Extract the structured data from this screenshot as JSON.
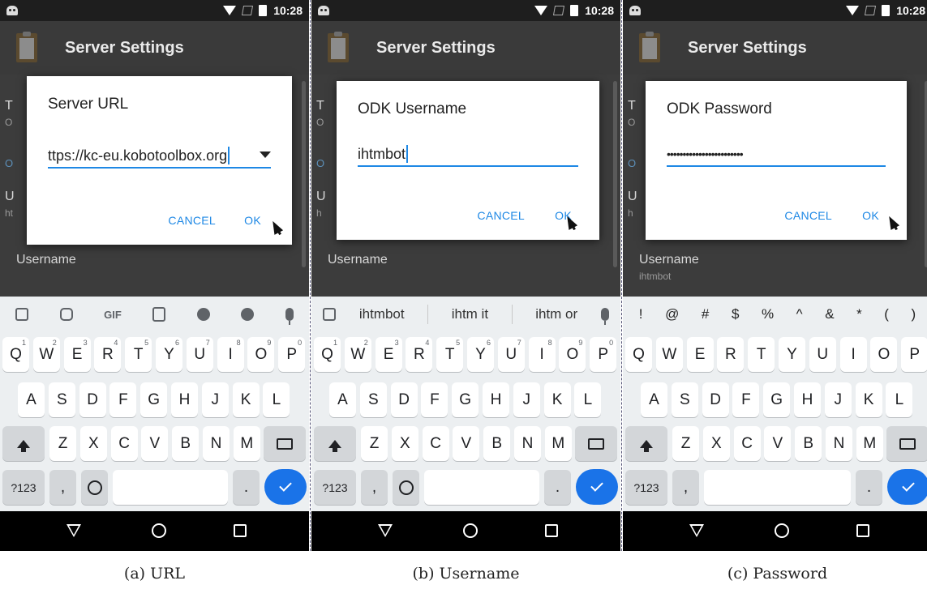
{
  "status_bar": {
    "time": "10:28"
  },
  "app_bar": {
    "title": "Server Settings"
  },
  "panels": [
    {
      "caption": "(a) URL",
      "dialog": {
        "title": "Server URL",
        "value": "ttps://kc-eu.kobotoolbox.org",
        "cancel": "CANCEL",
        "ok": "OK"
      },
      "background": {
        "item1_initial": "T",
        "item1_sub_initial": "O",
        "item2_initial": "O",
        "item3_initial": "U",
        "item3_sub_initial": "ht",
        "username_label": "Username",
        "username_value": ""
      },
      "keyboard": {
        "row1": [
          {
            "k": "Q",
            "h": "1"
          },
          {
            "k": "W",
            "h": "2"
          },
          {
            "k": "E",
            "h": "3"
          },
          {
            "k": "R",
            "h": "4"
          },
          {
            "k": "T",
            "h": "5"
          },
          {
            "k": "Y",
            "h": "6"
          },
          {
            "k": "U",
            "h": "7"
          },
          {
            "k": "I",
            "h": "8"
          },
          {
            "k": "O",
            "h": "9"
          },
          {
            "k": "P",
            "h": "0"
          }
        ],
        "row2": [
          "A",
          "S",
          "D",
          "F",
          "G",
          "H",
          "J",
          "K",
          "L"
        ],
        "row3": [
          "Z",
          "X",
          "C",
          "V",
          "B",
          "N",
          "M"
        ],
        "mode_key": "?123",
        "comma_key": ",",
        "period_key": "."
      }
    },
    {
      "caption": "(b) Username",
      "dialog": {
        "title": "ODK Username",
        "value": "ihtmbot",
        "cancel": "CANCEL",
        "ok": "OK"
      },
      "background": {
        "item1_initial": "T",
        "item1_sub_initial": "O",
        "item2_initial": "O",
        "item3_initial": "U",
        "item3_sub_initial": "h",
        "username_label": "Username",
        "username_value": ""
      },
      "suggestions": [
        "ihtmbot",
        "ihtm it",
        "ihtm or"
      ],
      "keyboard": {
        "row1": [
          {
            "k": "Q",
            "h": "1"
          },
          {
            "k": "W",
            "h": "2"
          },
          {
            "k": "E",
            "h": "3"
          },
          {
            "k": "R",
            "h": "4"
          },
          {
            "k": "T",
            "h": "5"
          },
          {
            "k": "Y",
            "h": "6"
          },
          {
            "k": "U",
            "h": "7"
          },
          {
            "k": "I",
            "h": "8"
          },
          {
            "k": "O",
            "h": "9"
          },
          {
            "k": "P",
            "h": "0"
          }
        ],
        "row2": [
          "A",
          "S",
          "D",
          "F",
          "G",
          "H",
          "J",
          "K",
          "L"
        ],
        "row3": [
          "Z",
          "X",
          "C",
          "V",
          "B",
          "N",
          "M"
        ],
        "mode_key": "?123",
        "comma_key": ",",
        "period_key": "."
      }
    },
    {
      "caption": "(c) Password",
      "dialog": {
        "title": "ODK Password",
        "value": "••••••••••••••••••••••••",
        "cancel": "CANCEL",
        "ok": "OK"
      },
      "background": {
        "item1_initial": "T",
        "item1_sub_initial": "O",
        "item2_initial": "O",
        "item3_initial": "U",
        "item3_sub_initial": "h",
        "username_label": "Username",
        "username_value": "ihtmbot"
      },
      "symbols": [
        "!",
        "@",
        "#",
        "$",
        "%",
        "^",
        "&",
        "*",
        "(",
        ")"
      ],
      "keyboard": {
        "row1": [
          {
            "k": "Q",
            "h": ""
          },
          {
            "k": "W",
            "h": ""
          },
          {
            "k": "E",
            "h": ""
          },
          {
            "k": "R",
            "h": ""
          },
          {
            "k": "T",
            "h": ""
          },
          {
            "k": "Y",
            "h": ""
          },
          {
            "k": "U",
            "h": ""
          },
          {
            "k": "I",
            "h": ""
          },
          {
            "k": "O",
            "h": ""
          },
          {
            "k": "P",
            "h": ""
          }
        ],
        "row2": [
          "A",
          "S",
          "D",
          "F",
          "G",
          "H",
          "J",
          "K",
          "L"
        ],
        "row3": [
          "Z",
          "X",
          "C",
          "V",
          "B",
          "N",
          "M"
        ],
        "mode_key": "?123",
        "comma_key": ",",
        "period_key": "."
      }
    }
  ],
  "toolbar_gif_label": "GIF",
  "colors": {
    "accent": "#1e88e5",
    "done_key": "#1a73e8",
    "app_bar": "#3a3a3a",
    "keyboard_bg": "#eceff1"
  }
}
